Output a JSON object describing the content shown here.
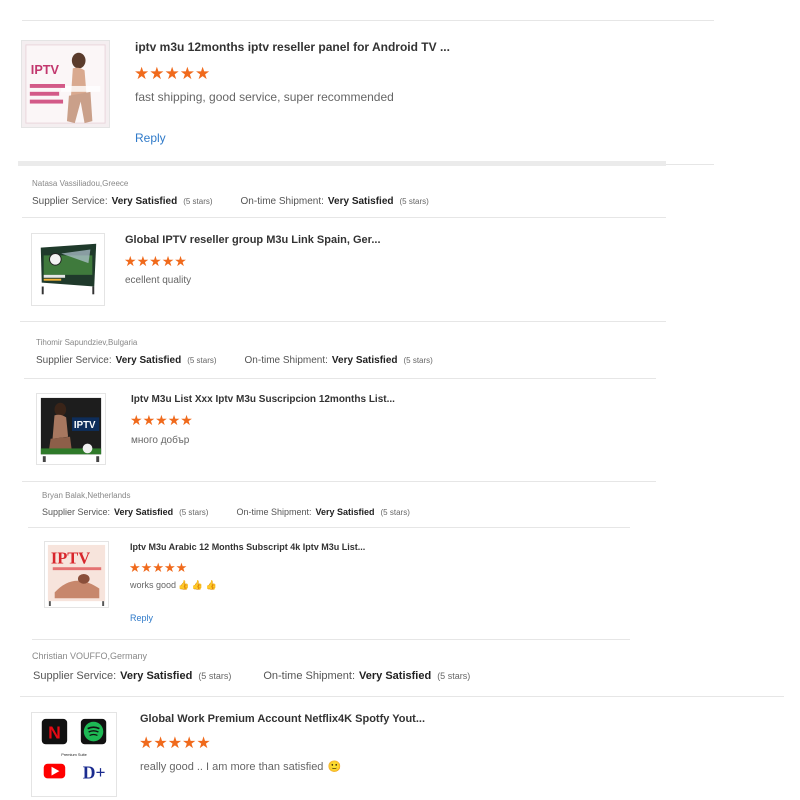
{
  "colors": {
    "star": "#f06a1c",
    "reply": "#2f7ac9",
    "divider": "#e6e6e6"
  },
  "labels": {
    "supplier": "Supplier Service:",
    "shipment": "On-time Shipment:",
    "reply": "Reply",
    "star_glyph": "★"
  },
  "reviews": [
    {
      "product": "iptv m3u 12months iptv reseller panel for Android TV ...",
      "rating": 5,
      "comment": "fast shipping, good service, super recommended",
      "reply": "Reply",
      "thumb_icon": "iptv-promo-image"
    },
    {
      "reviewer": "Natasa Vassiliadou,Greece",
      "supplier_value": "Very Satisfied",
      "supplier_stars": "(5 stars)",
      "shipment_value": "Very Satisfied",
      "shipment_stars": "(5 stars)",
      "product": "Global IPTV reseller group M3u Link Spain, Ger...",
      "rating": 5,
      "comment": "ecellent quality",
      "thumb_icon": "football-tv-image"
    },
    {
      "reviewer": "Tihomir Sapundziev,Bulgaria",
      "supplier_value": "Very Satisfied",
      "supplier_stars": "(5 stars)",
      "shipment_value": "Very Satisfied",
      "shipment_stars": "(5 stars)",
      "product": "Iptv M3u List Xxx Iptv M3u Suscripcion 12months List...",
      "rating": 5,
      "comment": "много добър",
      "thumb_icon": "iptv-tv-image"
    },
    {
      "reviewer": "Bryan Balak,Netherlands",
      "supplier_value": "Very Satisfied",
      "supplier_stars": "(5 stars)",
      "shipment_value": "Very Satisfied",
      "shipment_stars": "(5 stars)",
      "product": "Iptv M3u Arabic 12 Months Subscript 4k Iptv M3u List...",
      "rating": 5,
      "comment": "works good",
      "comment_emoji": "👍 👍 👍",
      "reply": "Reply",
      "thumb_icon": "iptv-red-banner-image"
    },
    {
      "reviewer": "Christian VOUFFO,Germany",
      "supplier_value": "Very Satisfied",
      "supplier_stars": "(5 stars)",
      "shipment_value": "Very Satisfied",
      "shipment_stars": "(5 stars)",
      "product": "Global Work Premium Account Netflix4K Spotfy Yout...",
      "rating": 5,
      "comment": "really good .. I am more than satisfied",
      "comment_emoji": "🙂",
      "thumb_icon": "streaming-apps-image",
      "thumb_letters": [
        "N",
        "D+"
      ],
      "thumb_caption": "Premium Suite"
    }
  ]
}
